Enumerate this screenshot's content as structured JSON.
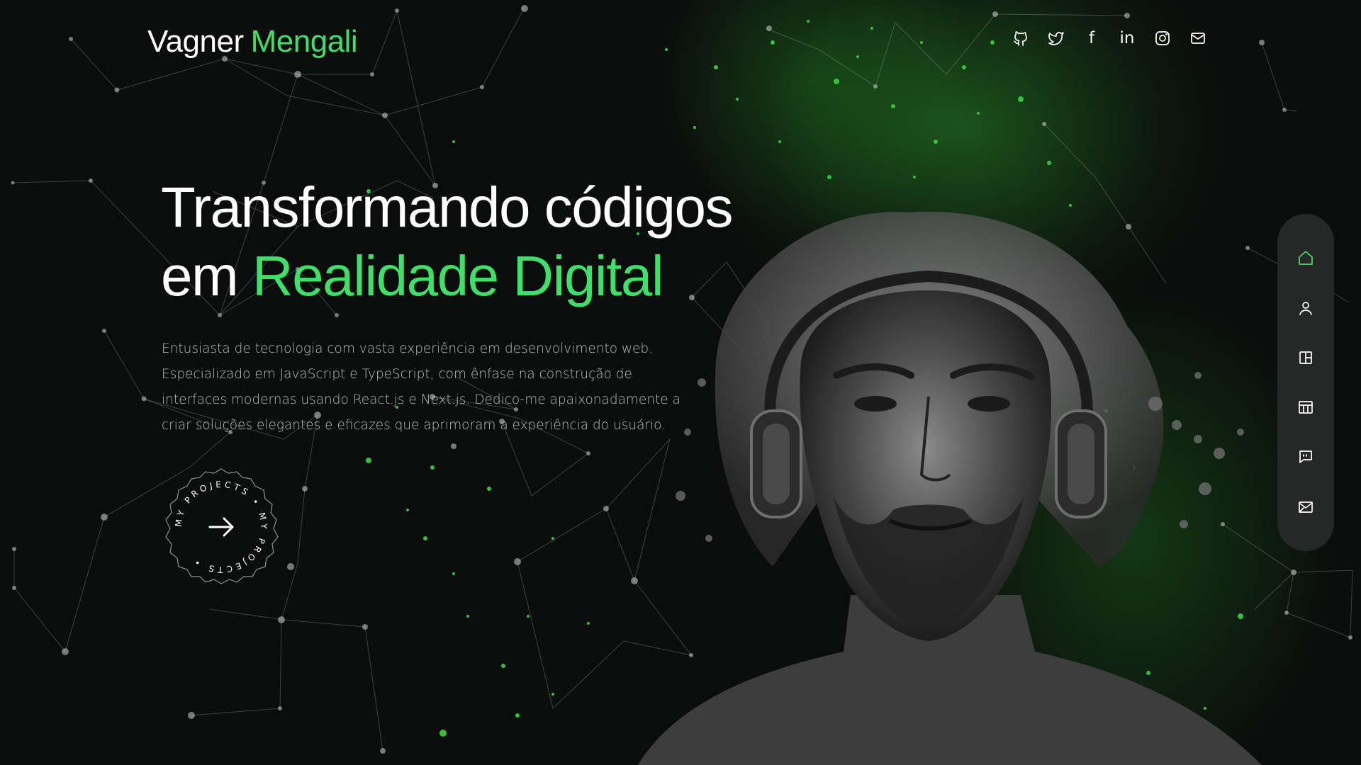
{
  "header": {
    "logo_first": "Vagner",
    "logo_last": "Mengali",
    "social_links": [
      {
        "icon": "github-icon"
      },
      {
        "icon": "twitter-icon"
      },
      {
        "icon": "facebook-icon",
        "label": "f"
      },
      {
        "icon": "linkedin-icon",
        "label": "in"
      },
      {
        "icon": "instagram-icon"
      },
      {
        "icon": "mail-icon"
      }
    ]
  },
  "hero": {
    "headline_line1": "Transformando códigos",
    "headline_line2_prefix": "em",
    "headline_line2_accent": "Realidade Digital",
    "description": "Entusiasta de tecnologia com vasta experiência em desenvolvimento web. Especializado em JavaScript e TypeScript, com ênfase na construção de interfaces modernas usando React.js e Next.js. Dedico-me apaixonadamente a criar soluções elegantes e eficazes que aprimoram a experiência do usuário.",
    "badge_text": "MY PROJECTS • MY PROJECTS •"
  },
  "sidenav": {
    "items": [
      {
        "icon": "home-icon",
        "active": true
      },
      {
        "icon": "user-icon",
        "active": false
      },
      {
        "icon": "services-icon",
        "active": false
      },
      {
        "icon": "work-icon",
        "active": false
      },
      {
        "icon": "testimonials-icon",
        "active": false
      },
      {
        "icon": "contact-icon",
        "active": false
      }
    ]
  },
  "colors": {
    "accent": "#3ee06a",
    "background": "#0b0c0c",
    "nav_bg": "#262727",
    "text_muted": "#b9bcbd"
  }
}
